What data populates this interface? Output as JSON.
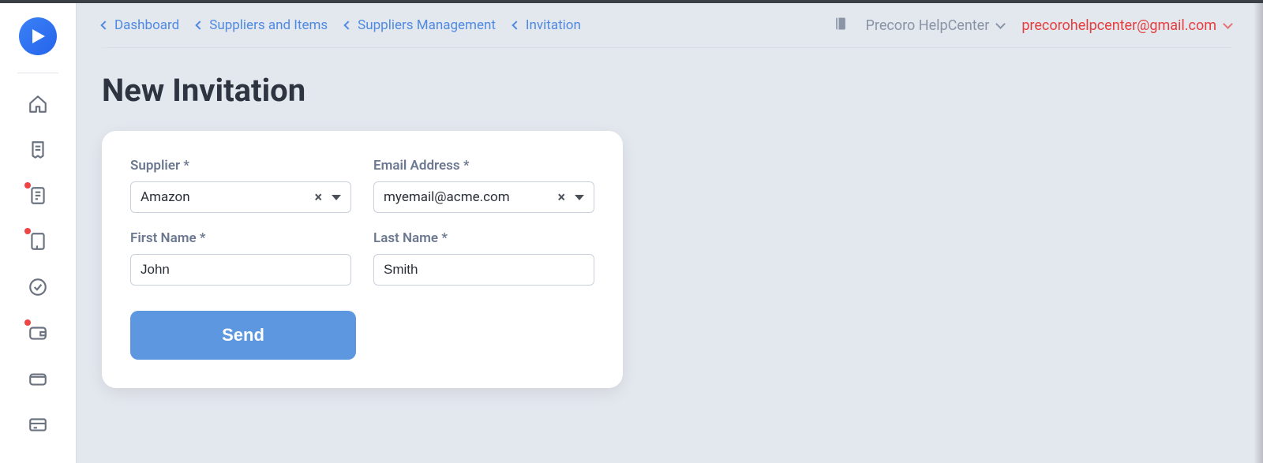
{
  "breadcrumbs": [
    {
      "label": "Dashboard"
    },
    {
      "label": "Suppliers and Items"
    },
    {
      "label": "Suppliers Management"
    },
    {
      "label": "Invitation"
    }
  ],
  "header": {
    "org_name": "Precoro HelpCenter",
    "user_email": "precorohelpcenter@gmail.com"
  },
  "page": {
    "title": "New Invitation"
  },
  "form": {
    "supplier": {
      "label": "Supplier *",
      "value": "Amazon"
    },
    "email": {
      "label": "Email Address *",
      "value": "myemail@acme.com"
    },
    "first_name": {
      "label": "First Name *",
      "value": "John"
    },
    "last_name": {
      "label": "Last Name *",
      "value": "Smith"
    },
    "submit_label": "Send"
  },
  "sidebar": {
    "items": [
      {
        "name": "home-icon",
        "notif": false
      },
      {
        "name": "receipt-icon",
        "notif": false
      },
      {
        "name": "doc1-icon",
        "notif": true
      },
      {
        "name": "doc2-icon",
        "notif": true
      },
      {
        "name": "check-circle-icon",
        "notif": false
      },
      {
        "name": "wallet-icon",
        "notif": true
      },
      {
        "name": "wallet2-icon",
        "notif": false
      },
      {
        "name": "card-icon",
        "notif": false
      }
    ]
  }
}
